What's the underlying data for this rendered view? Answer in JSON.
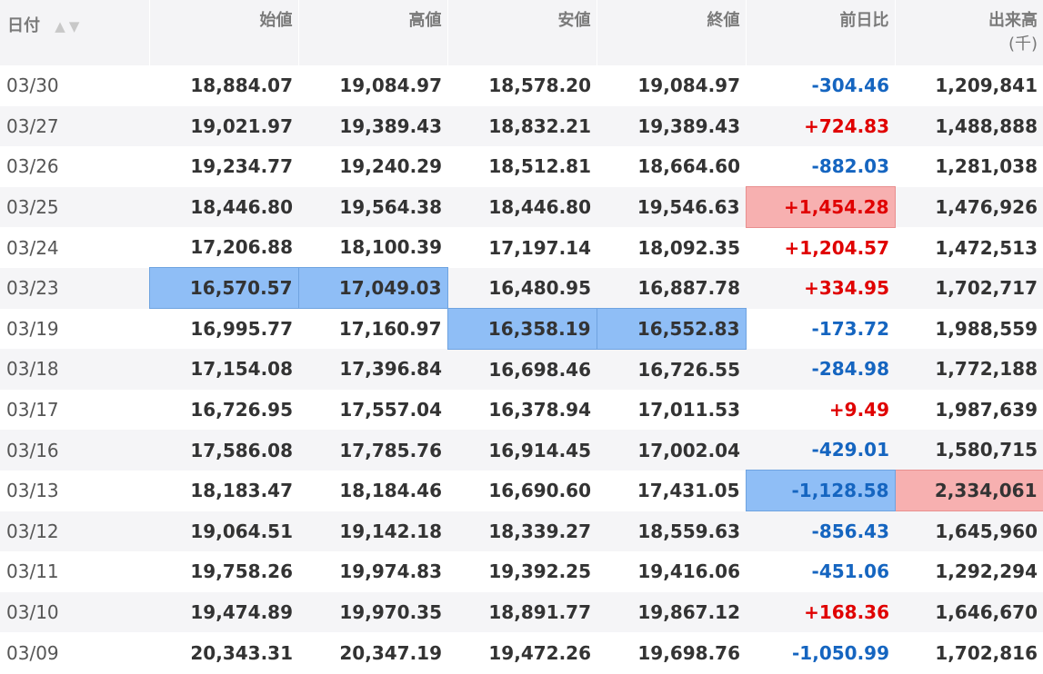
{
  "headers": {
    "date": "日付",
    "open": "始値",
    "high": "高値",
    "low": "安値",
    "close": "終値",
    "change": "前日比",
    "volume": "出来高",
    "volume_unit": "(千)"
  },
  "colors": {
    "up": "#e00000",
    "down": "#1565c0",
    "highlight_blue": "#8fbef6",
    "highlight_red": "#f7b0b0"
  },
  "rows": [
    {
      "date": "03/30",
      "open": "18,884.07",
      "high": "19,084.97",
      "low": "18,578.20",
      "close": "19,084.97",
      "change": "-304.46",
      "volume": "1,209,841"
    },
    {
      "date": "03/27",
      "open": "19,021.97",
      "high": "19,389.43",
      "low": "18,832.21",
      "close": "19,389.43",
      "change": "+724.83",
      "volume": "1,488,888"
    },
    {
      "date": "03/26",
      "open": "19,234.77",
      "high": "19,240.29",
      "low": "18,512.81",
      "close": "18,664.60",
      "change": "-882.03",
      "volume": "1,281,038"
    },
    {
      "date": "03/25",
      "open": "18,446.80",
      "high": "19,564.38",
      "low": "18,446.80",
      "close": "19,546.63",
      "change": "+1,454.28",
      "volume": "1,476,926"
    },
    {
      "date": "03/24",
      "open": "17,206.88",
      "high": "18,100.39",
      "low": "17,197.14",
      "close": "18,092.35",
      "change": "+1,204.57",
      "volume": "1,472,513"
    },
    {
      "date": "03/23",
      "open": "16,570.57",
      "high": "17,049.03",
      "low": "16,480.95",
      "close": "16,887.78",
      "change": "+334.95",
      "volume": "1,702,717"
    },
    {
      "date": "03/19",
      "open": "16,995.77",
      "high": "17,160.97",
      "low": "16,358.19",
      "close": "16,552.83",
      "change": "-173.72",
      "volume": "1,988,559"
    },
    {
      "date": "03/18",
      "open": "17,154.08",
      "high": "17,396.84",
      "low": "16,698.46",
      "close": "16,726.55",
      "change": "-284.98",
      "volume": "1,772,188"
    },
    {
      "date": "03/17",
      "open": "16,726.95",
      "high": "17,557.04",
      "low": "16,378.94",
      "close": "17,011.53",
      "change": "+9.49",
      "volume": "1,987,639"
    },
    {
      "date": "03/16",
      "open": "17,586.08",
      "high": "17,785.76",
      "low": "16,914.45",
      "close": "17,002.04",
      "change": "-429.01",
      "volume": "1,580,715"
    },
    {
      "date": "03/13",
      "open": "18,183.47",
      "high": "18,184.46",
      "low": "16,690.60",
      "close": "17,431.05",
      "change": "-1,128.58",
      "volume": "2,334,061"
    },
    {
      "date": "03/12",
      "open": "19,064.51",
      "high": "19,142.18",
      "low": "18,339.27",
      "close": "18,559.63",
      "change": "-856.43",
      "volume": "1,645,960"
    },
    {
      "date": "03/11",
      "open": "19,758.26",
      "high": "19,974.83",
      "low": "19,392.25",
      "close": "19,416.06",
      "change": "-451.06",
      "volume": "1,292,294"
    },
    {
      "date": "03/10",
      "open": "19,474.89",
      "high": "19,970.35",
      "low": "18,891.77",
      "close": "19,867.12",
      "change": "+168.36",
      "volume": "1,646,670"
    },
    {
      "date": "03/09",
      "open": "20,343.31",
      "high": "20,347.19",
      "low": "19,472.26",
      "close": "19,698.76",
      "change": "-1,050.99",
      "volume": "1,702,816"
    }
  ],
  "highlights": [
    {
      "row": 3,
      "col": "change",
      "type": "red"
    },
    {
      "row": 5,
      "col": "open",
      "type": "blue"
    },
    {
      "row": 5,
      "col": "high",
      "type": "blue"
    },
    {
      "row": 6,
      "col": "low",
      "type": "blue"
    },
    {
      "row": 6,
      "col": "close",
      "type": "blue"
    },
    {
      "row": 10,
      "col": "change",
      "type": "blue"
    },
    {
      "row": 10,
      "col": "volume",
      "type": "red"
    }
  ]
}
